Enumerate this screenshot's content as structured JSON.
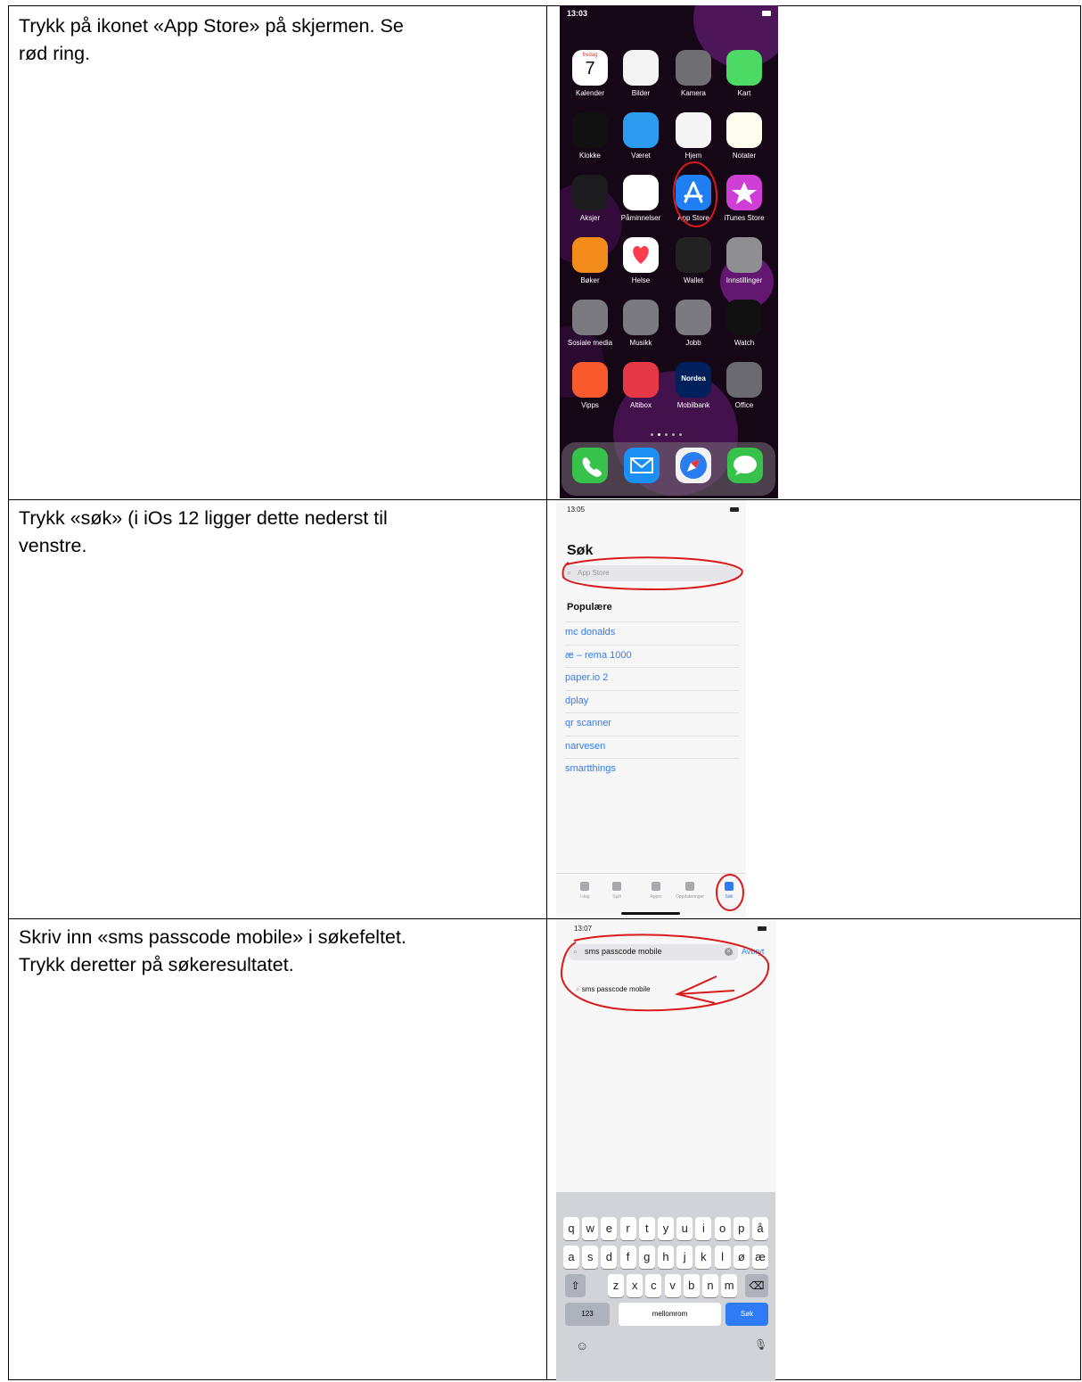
{
  "steps": [
    {
      "instruction_line1": "Trykk på ikonet «App Store» på skjermen. Se",
      "instruction_line2": "rød ring."
    },
    {
      "instruction_line1": "Trykk «søk» (i iOs 12 ligger dette nederst til",
      "instruction_line2": "venstre."
    },
    {
      "instruction_line1": "Skriv inn «sms passcode mobile» i søkefeltet.",
      "instruction_line2": "Trykk deretter på søkeresultatet."
    }
  ],
  "home_screen": {
    "time": "13:03",
    "calendar_weekday": "fredag",
    "calendar_day": "7",
    "apps": [
      "Kalender",
      "Bilder",
      "Kamera",
      "Kart",
      "Klokke",
      "Været",
      "Hjem",
      "Notater",
      "Aksjer",
      "Påminnelser",
      "App Store",
      "iTunes Store",
      "Bøker",
      "Helse",
      "Wallet",
      "Innstillinger",
      "Sosiale media",
      "Musikk",
      "Jobb",
      "Watch",
      "Vipps",
      "Altibox",
      "Mobilbank",
      "Office"
    ],
    "nordea_label": "Nordea"
  },
  "search_screen": {
    "time": "13:05",
    "title": "Søk",
    "placeholder": "App Store",
    "popular_heading": "Populære",
    "popular": [
      "mc donalds",
      "æ – rema 1000",
      "paper.io 2",
      "dplay",
      "qr scanner",
      "narvesen",
      "smartthings"
    ],
    "tabs": [
      "I dag",
      "Spill",
      "Apper",
      "Oppdateringer",
      "Søk"
    ]
  },
  "typing_screen": {
    "time": "13:07",
    "query": "sms passcode mobile",
    "cancel": "Avbryt",
    "suggestion": "sms passcode mobile",
    "keyboard_rows": [
      [
        "q",
        "w",
        "e",
        "r",
        "t",
        "y",
        "u",
        "i",
        "o",
        "p",
        "å"
      ],
      [
        "a",
        "s",
        "d",
        "f",
        "g",
        "h",
        "j",
        "k",
        "l",
        "ø",
        "æ"
      ],
      [
        "z",
        "x",
        "c",
        "v",
        "b",
        "n",
        "m"
      ]
    ],
    "key_123": "123",
    "key_space": "mellomrom",
    "key_search": "Søk"
  },
  "colors": {
    "annotation_red": "#d81a1a",
    "ios_blue": "#2f7bf6"
  }
}
